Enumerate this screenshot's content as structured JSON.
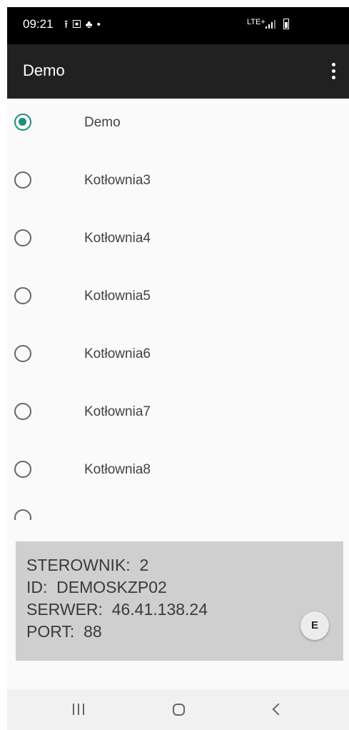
{
  "status_bar": {
    "time": "09:21",
    "network_label": "LTE+"
  },
  "toolbar": {
    "title": "Demo",
    "menu_icon": "more-vert-icon"
  },
  "list": {
    "items": [
      {
        "label": "Demo",
        "checked": true
      },
      {
        "label": "Kotłownia3",
        "checked": false
      },
      {
        "label": "Kotłownia4",
        "checked": false
      },
      {
        "label": "Kotłownia5",
        "checked": false
      },
      {
        "label": "Kotłownia6",
        "checked": false
      },
      {
        "label": "Kotłownia7",
        "checked": false
      },
      {
        "label": "Kotłownia8",
        "checked": false
      },
      {
        "label": "",
        "checked": false
      }
    ]
  },
  "info": {
    "sterownik": "STEROWNIK:  2",
    "id": "ID:  DEMOSKZP02",
    "serwer": "SERWER:  46.41.138.24",
    "port": "PORT:  88",
    "e_button": "E"
  },
  "colors": {
    "accent": "#1d8f7f",
    "toolbar": "#212121",
    "panel": "#cfcfcf"
  }
}
